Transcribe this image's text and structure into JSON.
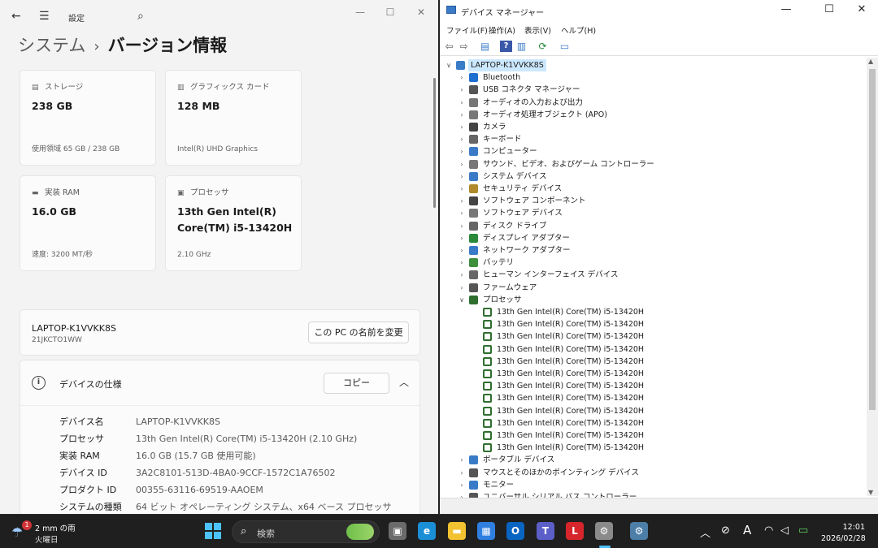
{
  "settings": {
    "title": "設定",
    "breadcrumb": {
      "parent": "システム",
      "separator": "›",
      "current": "バージョン情報"
    },
    "cards": {
      "storage": {
        "label": "ストレージ",
        "value": "238 GB",
        "sub": "使用領域 65 GB / 238 GB"
      },
      "graphics": {
        "label": "グラフィックス カード",
        "value": "128 MB",
        "sub": "Intel(R) UHD Graphics"
      },
      "ram": {
        "label": "実装 RAM",
        "value": "16.0 GB",
        "sub": "速度: 3200 MT/秒"
      },
      "processor": {
        "label": "プロセッサ",
        "value": "13th Gen Intel(R)\nCore(TM) i5-13420H",
        "sub": "2.10 GHz"
      }
    },
    "pc_name": "LAPTOP-K1VVKK8S",
    "model": "21JKCTO1WW",
    "rename_button": "この PC の名前を変更",
    "spec": {
      "title": "デバイスの仕様",
      "copy_button": "コピー",
      "rows": [
        {
          "key": "デバイス名",
          "value": "LAPTOP-K1VVKK8S"
        },
        {
          "key": "プロセッサ",
          "value": "13th Gen Intel(R) Core(TM) i5-13420H (2.10 GHz)"
        },
        {
          "key": "実装 RAM",
          "value": "16.0 GB (15.7 GB 使用可能)"
        },
        {
          "key": "デバイス ID",
          "value": "3A2C8101-513D-4BA0-9CCF-1572C1A76502"
        },
        {
          "key": "プロダクト ID",
          "value": "00355-63116-69519-AAOEM"
        },
        {
          "key": "システムの種類",
          "value": "64 ビット オペレーティング システム、x64 ベース プロセッサ"
        }
      ]
    }
  },
  "devmgr": {
    "title": "デバイス マネージャー",
    "menu": [
      "ファイル(F)",
      "操作(A)",
      "表示(V)",
      "ヘルプ(H)"
    ],
    "root": "LAPTOP-K1VVKK8S",
    "categories_before": [
      "Bluetooth",
      "USB コネクタ マネージャー",
      "オーディオの入力および出力",
      "オーディオ処理オブジェクト (APO)",
      "カメラ",
      "キーボード",
      "コンピューター",
      "サウンド、ビデオ、およびゲーム コントローラー",
      "システム デバイス",
      "セキュリティ デバイス",
      "ソフトウェア コンポーネント",
      "ソフトウェア デバイス",
      "ディスク ドライブ",
      "ディスプレイ アダプター",
      "ネットワーク アダプター",
      "バッテリ",
      "ヒューマン インターフェイス デバイス",
      "ファームウェア"
    ],
    "expanded_category": "プロセッサ",
    "processors": [
      "13th Gen Intel(R) Core(TM) i5-13420H",
      "13th Gen Intel(R) Core(TM) i5-13420H",
      "13th Gen Intel(R) Core(TM) i5-13420H",
      "13th Gen Intel(R) Core(TM) i5-13420H",
      "13th Gen Intel(R) Core(TM) i5-13420H",
      "13th Gen Intel(R) Core(TM) i5-13420H",
      "13th Gen Intel(R) Core(TM) i5-13420H",
      "13th Gen Intel(R) Core(TM) i5-13420H",
      "13th Gen Intel(R) Core(TM) i5-13420H",
      "13th Gen Intel(R) Core(TM) i5-13420H",
      "13th Gen Intel(R) Core(TM) i5-13420H",
      "13th Gen Intel(R) Core(TM) i5-13420H"
    ],
    "categories_after": [
      "ポータブル デバイス",
      "マウスとそのほかのポインティング デバイス",
      "モニター",
      "ユニバーサル シリアル バス コントローラー"
    ],
    "category_icon_colors": [
      "#1f6fd1",
      "#555555",
      "#777777",
      "#777777",
      "#444444",
      "#666666",
      "#3a7bc8",
      "#777777",
      "#3a7bc8",
      "#b08a2a",
      "#444444",
      "#777777",
      "#666666",
      "#2a8a3a",
      "#3a7bc8",
      "#3d8f3d",
      "#666666",
      "#555555"
    ],
    "after_icon_colors": [
      "#3a7bc8",
      "#555555",
      "#3a7bc8",
      "#555555"
    ]
  },
  "taskbar": {
    "weather_badge": "1",
    "weather_line1": "2 mm の雨",
    "weather_line2": "火曜日",
    "search_placeholder": "検索",
    "apps": [
      {
        "name": "task-view",
        "color": "#6b6b6b",
        "glyph": "▣"
      },
      {
        "name": "edge",
        "color": "#1b8fd6",
        "glyph": "e"
      },
      {
        "name": "file-explorer",
        "color": "#f2c230",
        "glyph": "▬"
      },
      {
        "name": "store",
        "color": "#2f7fe0",
        "glyph": "▦"
      },
      {
        "name": "outlook",
        "color": "#0a64c2",
        "glyph": "O"
      },
      {
        "name": "teams",
        "color": "#5b5fc7",
        "glyph": "T"
      },
      {
        "name": "red-l-app",
        "color": "#d6262b",
        "glyph": "L"
      },
      {
        "name": "device-manager",
        "color": "#8a8a8a",
        "glyph": "⚙"
      },
      {
        "name": "settings",
        "color": "#4c7ea8",
        "glyph": "⚙"
      }
    ],
    "ime": "A",
    "time": "12:01",
    "date": "2026/02/28"
  }
}
